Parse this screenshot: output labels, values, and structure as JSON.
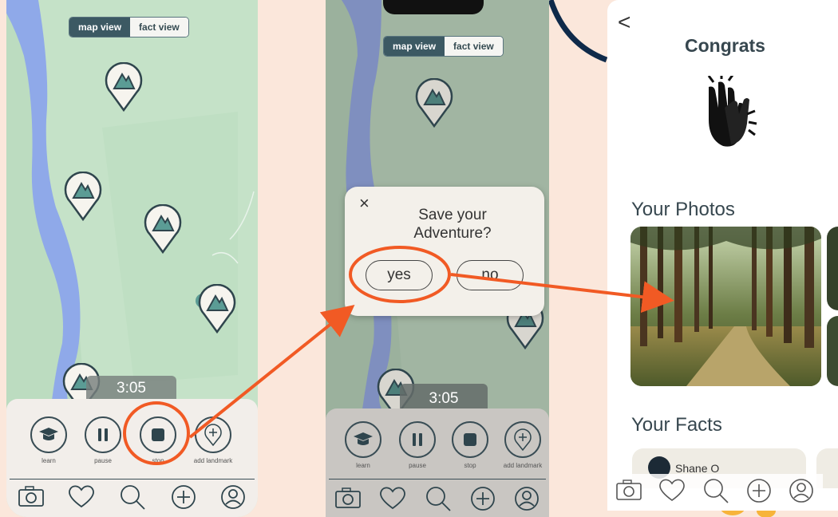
{
  "toggle": {
    "map_view": "map view",
    "fact_view": "fact view"
  },
  "timer": "3:05",
  "controls": {
    "learn": "learn",
    "pause": "pause",
    "stop": "stop",
    "add_landmark": "add landmark"
  },
  "dialog": {
    "close": "×",
    "question": "Save your Adventure?",
    "yes": "yes",
    "no": "no"
  },
  "congrats": {
    "back": "<",
    "title": "Congrats",
    "photos_heading": "Your Photos",
    "facts_heading": "Your Facts",
    "fact_author": "Shane O"
  },
  "icons": [
    "camera-icon",
    "heart-icon",
    "search-icon",
    "plus-circle-icon",
    "profile-icon"
  ],
  "colors": {
    "accent": "#f15a24",
    "dark": "#394d55",
    "map_green": "#c6e3c9",
    "river": "#8fa9e9",
    "pin_fill": "#5b9c95"
  }
}
